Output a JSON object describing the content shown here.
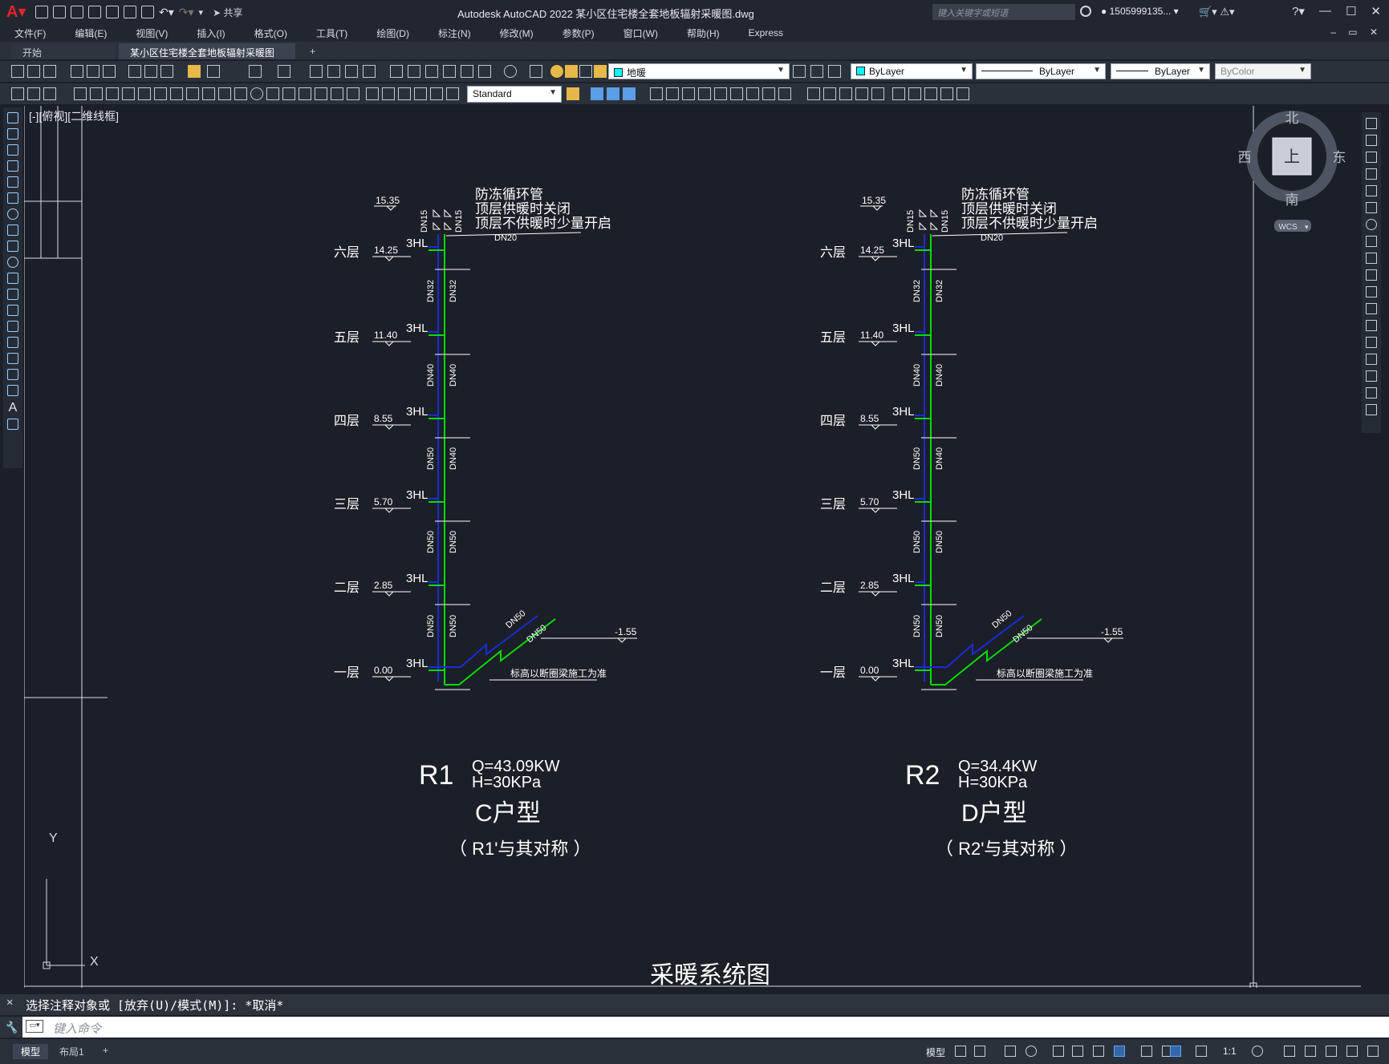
{
  "app": {
    "title": "Autodesk AutoCAD 2022    某小区住宅楼全套地板辐射采暖图.dwg",
    "share_label": "共享",
    "search_placeholder": "键入关键字或短语",
    "user": "1505999135...",
    "help": "?"
  },
  "menu": [
    "文件(F)",
    "编辑(E)",
    "视图(V)",
    "插入(I)",
    "格式(O)",
    "工具(T)",
    "绘图(D)",
    "标注(N)",
    "修改(M)",
    "参数(P)",
    "窗口(W)",
    "帮助(H)",
    "Express"
  ],
  "tabs": {
    "start": "开始",
    "active": "某小区住宅楼全套地板辐射采暖图*",
    "add": "+"
  },
  "toolbar": {
    "layer": "地暖",
    "layer_color": "#00ffff",
    "color": "ByLayer",
    "linetype": "ByLayer",
    "lineweight": "ByLayer",
    "plotstyle": "ByColor",
    "textstyle": "Standard"
  },
  "viewport_label": "[-][俯视][二维线框]",
  "viewcube": {
    "north": "北",
    "south": "南",
    "east": "东",
    "west": "西",
    "top": "上",
    "wcs": "WCS"
  },
  "ucs": {
    "x": "X",
    "y": "Y"
  },
  "drawing": {
    "top_elevation": "15.35",
    "valve_labels": [
      "DN15",
      "DN15"
    ],
    "note_lines": [
      "防冻循环管",
      "顶层供暖时关闭",
      "顶层不供暖时少量开启"
    ],
    "top_pipe": "DN20",
    "floors": [
      {
        "name": "六层",
        "elev": "14.25"
      },
      {
        "name": "五层",
        "elev": "11.40"
      },
      {
        "name": "四层",
        "elev": "8.55"
      },
      {
        "name": "三层",
        "elev": "5.70"
      },
      {
        "name": "二层",
        "elev": "2.85"
      },
      {
        "name": "一层",
        "elev": "0.00"
      }
    ],
    "hl_label": "3HL",
    "segments": [
      {
        "left": "DN32",
        "right": "DN32"
      },
      {
        "left": "DN40",
        "right": "DN40"
      },
      {
        "left": "DN50",
        "right": "DN40"
      },
      {
        "left": "DN50",
        "right": "DN50"
      },
      {
        "left": "DN50",
        "right": "DN50"
      }
    ],
    "base_pipe_a": "DN50",
    "base_pipe_b": "DN50",
    "base_elev": "-1.55",
    "base_note": "标高以断圈梁施工为准",
    "systems": [
      {
        "id": "R1",
        "q": "Q=43.09KW",
        "h": "H=30KPa",
        "type": "C户型",
        "sym": "（  R1'与其对称  ）"
      },
      {
        "id": "R2",
        "q": "Q=34.4KW",
        "h": "H=30KPa",
        "type": "D户型",
        "sym": "（  R2'与其对称  ）"
      }
    ],
    "sheet_title": "采暖系统图"
  },
  "command": {
    "history": "选择注释对象或 [放弃(U)/模式(M)]: *取消*",
    "placeholder": "键入命令"
  },
  "status": {
    "tabs": [
      "模型",
      "布局1",
      "+"
    ],
    "model_label": "模型",
    "scale": "1:1"
  }
}
